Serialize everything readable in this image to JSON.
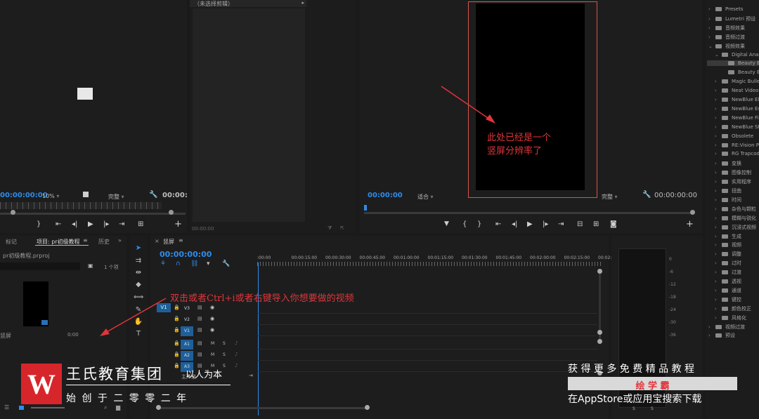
{
  "source_monitor": {
    "timecode_left": "00:00:00:00",
    "zoom": "10%",
    "quality": "完整",
    "timecode_right": "00:00:"
  },
  "effect_controls": {
    "header": "（未选择剪辑）",
    "footer_time": "00:00:00"
  },
  "program_monitor": {
    "timecode_left": "00:00:00",
    "fit": "适合",
    "quality": "完整",
    "timecode_right": "00:00:00:00"
  },
  "annotations": {
    "vertical_note_line1": "此处已经是一个",
    "vertical_note_line2": "竖屏分辨率了",
    "import_note": "双击或者Ctrl+i或者右键导入你想要做的视频"
  },
  "project_panel": {
    "tabs": [
      "标记",
      "项目: pr初级教程",
      "历史"
    ],
    "project_file": "pr初级教程.prproj",
    "item_count": "1 个项",
    "clip_name": "竖屏",
    "clip_duration": "0:00"
  },
  "timeline": {
    "sequence_tab": "竖屏",
    "timecode": "00:00:00:00",
    "ruler": [
      ":00:00",
      "00:00:15:00",
      "00:00:30:00",
      "00:00:45:00",
      "00:01:00:00",
      "00:01:15:00",
      "00:01:30:00",
      "00:01:45:00",
      "00:02:00:00",
      "00:02:15:00",
      "00:02:3"
    ],
    "video_tracks": [
      "V3",
      "V2",
      "V1"
    ],
    "audio_tracks": [
      "A1",
      "A2",
      "A3"
    ],
    "source_patch_v": "V1",
    "master": "主声道",
    "track_letters": {
      "mute": "M",
      "solo": "S"
    }
  },
  "effects_tree": [
    {
      "label": "Presets",
      "level": 0,
      "open": false
    },
    {
      "label": "Lumetri 预设",
      "level": 0,
      "open": false
    },
    {
      "label": "音频效果",
      "level": 0,
      "open": false
    },
    {
      "label": "音频过渡",
      "level": 0,
      "open": false
    },
    {
      "label": "视频效果",
      "level": 0,
      "open": true
    },
    {
      "label": "Digital Anarc",
      "level": 1,
      "open": true
    },
    {
      "label": "Beauty Bo",
      "level": 2,
      "selected": true
    },
    {
      "label": "Beauty Bo",
      "level": 2
    },
    {
      "label": "Magic Bullet",
      "level": 1
    },
    {
      "label": "Neat Video",
      "level": 1
    },
    {
      "label": "NewBlue Ele",
      "level": 1
    },
    {
      "label": "NewBlue Ess",
      "level": 1
    },
    {
      "label": "NewBlue Filt",
      "level": 1
    },
    {
      "label": "NewBlue Sty",
      "level": 1
    },
    {
      "label": "Obsolete",
      "level": 1
    },
    {
      "label": "RE:Vision Plu",
      "level": 1
    },
    {
      "label": "RG Trapcode",
      "level": 1
    },
    {
      "label": "变换",
      "level": 1
    },
    {
      "label": "图像控制",
      "level": 1
    },
    {
      "label": "实用程序",
      "level": 1
    },
    {
      "label": "扭曲",
      "level": 1
    },
    {
      "label": "时间",
      "level": 1
    },
    {
      "label": "杂色与颗粒",
      "level": 1
    },
    {
      "label": "模糊与锐化",
      "level": 1
    },
    {
      "label": "沉浸式视频",
      "level": 1
    },
    {
      "label": "生成",
      "level": 1
    },
    {
      "label": "视频",
      "level": 1
    },
    {
      "label": "调整",
      "level": 1
    },
    {
      "label": "过时",
      "level": 1
    },
    {
      "label": "过渡",
      "level": 1
    },
    {
      "label": "透视",
      "level": 1
    },
    {
      "label": "通道",
      "level": 1
    },
    {
      "label": "键控",
      "level": 1
    },
    {
      "label": "颜色校正",
      "level": 1
    },
    {
      "label": "风格化",
      "level": 1
    },
    {
      "label": "视频过渡",
      "level": 0
    },
    {
      "label": "预设",
      "level": 0
    }
  ],
  "audio_meter": {
    "db_labels": [
      "0",
      "-6",
      "-12",
      "-18",
      "-24",
      "-30",
      "-36"
    ]
  },
  "watermark": {
    "logo_letter": "W",
    "company": "王氏教育集团",
    "slogan": "以人为本",
    "founded": "始 创 于 二 零 零 二 年",
    "promo_line1": "获 得 更 多 免 费 精 品 教 程",
    "promo_brand": "绘 学 霸",
    "promo_line3": "在AppStore或应用宝搜索下载",
    "meter_labels": [
      "S",
      "S"
    ]
  },
  "colors": {
    "accent": "#2d8ceb",
    "annotation": "#e0353a",
    "panel_bg": "#1d1d1d"
  }
}
